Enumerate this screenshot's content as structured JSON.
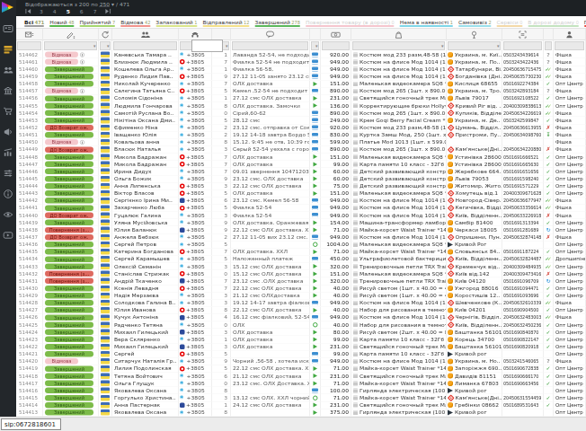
{
  "topbar": {
    "showing_prefix": "Відображаються з 200 по ",
    "showing_to": "250",
    "showing_suffix": " ▾ / 471",
    "pages": [
      "3",
      "4",
      "5",
      "6",
      "7"
    ],
    "current_page": "5"
  },
  "tabs": [
    {
      "label": "Всі",
      "count": "471",
      "color": "#9e9e9e",
      "active": true,
      "dim": false
    },
    {
      "label": "Новий",
      "count": "48",
      "color": "#57b94c",
      "active": false,
      "dim": false
    },
    {
      "label": "Прийнятий",
      "count": "7",
      "color": "#a5d66e",
      "active": false,
      "dim": false
    },
    {
      "label": "Відмова",
      "count": "42",
      "color": "#f1948d",
      "active": false,
      "dim": false
    },
    {
      "label": "Запакований",
      "count": "1",
      "color": "#d9e48a",
      "active": false,
      "dim": false
    },
    {
      "label": "Відправлений",
      "count": "12",
      "color": "#f3e08a",
      "active": false,
      "dim": false
    },
    {
      "label": "Завершений",
      "count": "278",
      "color": "#5cb85c",
      "active": false,
      "dim": false
    },
    {
      "label": "Повернення товару (в дорозі)",
      "count": "0",
      "color": "#f5c6ce",
      "active": false,
      "dim": true
    },
    {
      "label": "Нема в наявності",
      "count": "1",
      "color": "#7fd6e8",
      "active": false,
      "dim": false
    },
    {
      "label": "Самовивіз",
      "count": "2",
      "color": "#9adfeb",
      "active": false,
      "dim": false
    },
    {
      "label": "Сервіси",
      "count": "0",
      "color": "#f3d9a8",
      "active": false,
      "dim": true
    },
    {
      "label": "В дорозі додому",
      "count": "0",
      "color": "#c4e3c0",
      "active": false,
      "dim": true
    },
    {
      "label": "Пов",
      "count": "",
      "color": "#e6483c",
      "active": false,
      "dim": false
    }
  ],
  "sidebar_icons": [
    "logo",
    "id-card",
    "orders-list",
    "clients",
    "company",
    "cart",
    "megaphone",
    "stats",
    "settings-sliders",
    "info",
    "watch",
    "video"
  ],
  "columns": [
    "id",
    "status",
    "channel",
    "client",
    "phone",
    "calls-count",
    "comment",
    "payment",
    "amount",
    "products",
    "delivery-address",
    "tracking-number",
    "delivery-state",
    "source"
  ],
  "statuses": {
    "done": {
      "label": "Завершений",
      "bg": "#7cbb49",
      "fg": "#2f5c15",
      "w": 108
    },
    "refuse": {
      "label": "Відмова",
      "bg": "#f5c9cd",
      "fg": "#9c4352",
      "w": 74
    },
    "retw": {
      "label": "ДО Возврат ож.",
      "bg": "#dd695f",
      "fg": "#6e120b",
      "w": 108
    },
    "ret": {
      "label": "Повернення (з...",
      "bg": "#dd695f",
      "fg": "#6e120b",
      "w": 108
    }
  },
  "phone_prefix": "+3805",
  "table_rows": [
    [
      "514462",
      "refuse",
      true,
      "Каневська Тамара ..",
      "ks",
      "1",
      "Лаванда 52-54, не подходит",
      "card",
      "920.00",
      "Костюм мод 233 разм,48-58 (1..",
      "up",
      "Украина, м. Киї..",
      "0503243439614",
      "q",
      "Фішка"
    ],
    [
      "514461",
      "refuse",
      true,
      "Близнюк Людмила ..",
      "vf",
      "7",
      "Фиалка 52-54 не подходит",
      "card",
      "949.00",
      "Костюм на флисе Мод 1014 (1ш..",
      "up",
      "Украина, м. По..",
      "0503243422436",
      "q",
      "Фішка"
    ],
    [
      "514460",
      "done",
      false,
      "Кошелева Ольга Ар..",
      "ks",
      "1",
      "Фиалка 56-58,",
      "card",
      "949.00",
      "Костюм на флисе Мод 1014 (1ш..",
      "np",
      "Татарбунари, Ві..",
      "20450636715475",
      "ok2",
      "Фішка"
    ],
    [
      "514459",
      "done",
      false,
      "Руденко Лидия Пав..",
      "vf",
      "9",
      "27.12 11-05 занято 23.12 смс. ..",
      "card",
      "949.00",
      "Костюм на флисе Мод 1014 (1ш..",
      "np",
      "Богданівка (Дні..",
      "20450635730230",
      "ok2",
      "Фішка"
    ],
    [
      "514458",
      "done",
      false,
      "Николай Кучеренко",
      "ks",
      "7",
      "ОЛХ доставка",
      "cash",
      "151.00",
      "Маленькая видеокамера SQ8 *..",
      "up",
      "Кислиця 68655",
      "0501692274384",
      "ok",
      "Опт Центр"
    ],
    [
      "514457",
      "refuse",
      true,
      "Салєгина Татьяна С..",
      "vf",
      "5",
      "Кемел ,52-54 не подходит",
      "card",
      "890.00",
      "Костюм мод 265 (1шт. x 890.00 ..",
      "up",
      "Украина, м. Тро..",
      "0503242893184",
      "q",
      "Фішка"
    ],
    [
      "514456",
      "done",
      false,
      "Соломія Сідоніна",
      "ks",
      "1",
      "27.12 смс ОЛХ доставка",
      "cash",
      "231.00",
      "Светящийся гоночный трек Ma..",
      "up",
      "Львів 79017",
      "0501692108522",
      "ok",
      "Опт Центр"
    ],
    [
      "514455",
      "done",
      false,
      "Людмила Гончарова",
      "ks",
      "8",
      "ОЛХ доставка. Замочки",
      "cash",
      "136.00",
      "Корректирующие брюки Hollyw..",
      "np",
      "Кривий Ріг від. ..",
      "20400309838613",
      "ok2",
      "Опт Центр"
    ],
    [
      "514454",
      "done",
      false,
      "Самотій Руслана Во..",
      "ks",
      "0",
      "Сірий,60-62",
      "card",
      "890.00",
      "Костюм мод 265 (1шт. x 890.00 ..",
      "np",
      "Купиків, Відділе..",
      "20450634226619",
      "ok2",
      "Фішка"
    ],
    [
      "514453",
      "done",
      false,
      "Нікітіна Оксана Дми..",
      "ks",
      "5",
      "28.12 смс",
      "card",
      "249.00",
      "Крем Goqi Berry Facial Cream *3..",
      "up",
      "Украина, м. Де..",
      "0503242599847",
      "ok",
      "Фішка"
    ],
    [
      "514452",
      "retw",
      false,
      "Єфименко Ніна",
      "ks",
      "2",
      "23.12 смс. отправка от Сокол..",
      "card",
      "920.00",
      "Костюм мод 233 разм,48-58 (1..",
      "np",
      "Цумань, Віддiл..",
      "20450636613955",
      "red",
      "Фішка"
    ],
    [
      "514451",
      "done",
      false,
      "Іващенко Юлія",
      "ks",
      "2",
      "19.12 14-18 завтра Бордо 56-58",
      "card",
      "830.00",
      "Куртка Замш Мод, 250 (1шт. x 8..",
      "np",
      "Пристроми, Пу..",
      "20450634098760",
      "in",
      "Фішка"
    ],
    [
      "514450",
      "refuse",
      true,
      "Ковальова анна",
      "ks",
      "8",
      "15.12. 9:45 не отв, 10:39 горе в..",
      "card",
      "599.00",
      "Платье Mod 1013 (1шт. x 599.00 ..",
      "",
      "",
      "",
      "",
      "Фішка"
    ],
    [
      "514449",
      "retw",
      false,
      "Власюк Наталья",
      "ks",
      "3",
      "Серый 52-54 уехала с города",
      "card",
      "890.00",
      "Костюм мод 265 (1шт. x 890.00 ..",
      "np",
      "Кам'янське(Дні..",
      "20450634220880",
      "red",
      "Фішка"
    ],
    [
      "514448",
      "done",
      false,
      "Микола Бадражан",
      "vf",
      "7",
      "ОЛХ доставка",
      "cash",
      "151.00",
      "Маленькая видеокамера SQ8 *..",
      "up",
      "Устинівка 28600",
      "0501691666521",
      "ok",
      "Опт Центр"
    ],
    [
      "514447",
      "done",
      false,
      "Микола Бадражан",
      "vf",
      "7",
      "ОЛХ доставка",
      "cash",
      "99.00",
      "Карта памяти 10 класс - 32Гб *1..",
      "up",
      "Устинівка 28600",
      "0501691665630",
      "ok",
      "Опт Центр"
    ],
    [
      "514446",
      "done",
      false,
      "Ирина Дидух",
      "ks",
      "7",
      "09.01 звернення 10471203 04...",
      "cash",
      "60.00",
      "Детский развивающий констру..",
      "up",
      "Жеребкове 664..",
      "0501691651656",
      "ok",
      "Опт Центр"
    ],
    [
      "514445",
      "done",
      false,
      "Ольга Божик",
      "ks",
      "9",
      "23.12 смс. ОЛХ доставка",
      "cash",
      "60.00",
      "Детский развивающий констру..",
      "up",
      "Львів 79053",
      "0501691598240",
      "ok",
      "Опт Центр"
    ],
    [
      "514444",
      "done",
      false,
      "Анна Липенська",
      "vf",
      "3",
      "22.12 смс ОЛХ доставка",
      "cash",
      "75.00",
      "Детский развивающий констру..",
      "up",
      "Житомир, Жито..",
      "0501691571229",
      "ok",
      "Опт Центр"
    ],
    [
      "514443",
      "done",
      false,
      "Віктор Власов",
      "vf",
      "5",
      "ОЛХ доставка",
      "cash",
      "151.00",
      "Маленькая видеокамера SQ8 *..",
      "np",
      "Хомутець від.1",
      "20400309671628",
      "ok",
      "Опт Центр"
    ],
    [
      "514442",
      "done",
      false,
      "Сергієнко Ірина Ми..",
      "lc",
      "6",
      "23.12 смс. Кемел 56-58",
      "card",
      "949.00",
      "Костюм на флисе Мод 1014 (1ш..",
      "np",
      "Новгород-Сівер..",
      "20450636677947",
      "ok2",
      "Фішка"
    ],
    [
      "514441",
      "done",
      false,
      "Захарченко Люба",
      "vf",
      "5",
      "Фиалка 52-54",
      "card",
      "949.00",
      "Костюм на флисе Мод 1014 (1ш..",
      "np",
      "Кегичівка, Відді..",
      "20450633356614",
      "ok2",
      "Фішка"
    ],
    [
      "514440",
      "retw",
      false,
      "Гуцалюк Галина",
      "ks",
      "3",
      "Фиалка 52-54",
      "card",
      "949.00",
      "Костюм на флисе Мод 1014 (1ш..",
      "np",
      "Київ, Відділенн..",
      "20450633226918",
      "red",
      "Фішка"
    ],
    [
      "514439",
      "done",
      false,
      "Уляна Мусійовська",
      "ks",
      "9",
      "ОЛХ доставка. Оранжевая",
      "cash",
      "154.00",
      "Машина-трансформер ламборд..",
      "up",
      "Самбір 81400",
      "0501691313394",
      "ok",
      "Опт Центр"
    ],
    [
      "514438",
      "ret",
      false,
      "Юлия Баланюк",
      "lc",
      "9",
      "22.12 смс ОЛХ доставка. ХХЛ",
      "cash",
      "71.00",
      "Майка-корсет Waist Trainer *142..",
      "up",
      "Черкаси 18005",
      "0501691281689",
      "refresh",
      "Опт Центр"
    ],
    [
      "514437",
      "retw",
      false,
      "Анжела Бебзюк",
      "ks",
      "2",
      "27.12 11-05 вих 23.12 смс. 19...",
      "card",
      "949.00",
      "Костюм на флисе Мод 1014 (1ш..",
      "np",
      "Опришени, Пун..",
      "20450632874148",
      "red",
      "Фішка"
    ],
    [
      "514436",
      "done",
      false,
      "Сергей Петров",
      "ks",
      "5",
      "",
      "money",
      "1004.00",
      "Маленькая видеокамера SQ8 *..",
      "dark",
      "Кривой Рог",
      "",
      "",
      "Опт Центр"
    ],
    [
      "514435",
      "done",
      false,
      "Катерина Богданова",
      "vf",
      "7",
      "ОЛХ доставка. ХХЛ",
      "cash",
      "71.00",
      "Майка-корсет Waist Trainer *142..",
      "up",
      "Словьянськ 84..",
      "0501691187224",
      "ok",
      "Опт Центр"
    ],
    [
      "514434",
      "done",
      false,
      "Сергей Карамышев",
      "ks",
      "5",
      "Наложенный платеж",
      "card",
      "450.00",
      "Ультрафиолетовой бактерицид..",
      "np",
      "Київ, Відділенн..",
      "20450632824487",
      "ok2",
      "Дропшипінг"
    ],
    [
      "514433",
      "done",
      false,
      "Олексій Семанін",
      "ks",
      "3",
      "15.12 смс ОЛХ доставка",
      "cash",
      "320.00",
      "Тренировочные петли TRX Train..",
      "np",
      "Кременчук від..",
      "20400309484935",
      "ok2",
      "Опт Центр"
    ],
    [
      "514432",
      "ret",
      false,
      "Станіслав Стрижак",
      "vf",
      "0",
      "15.12 смс ОЛХ доставка",
      "cash",
      "151.00",
      "Маленькая видеокамера SQ8 *..",
      "np",
      "Київ від.142",
      "20400309473416",
      "red",
      "Опт Центр"
    ],
    [
      "514431",
      "ret",
      false,
      "Андрій Ткаченко",
      "lc",
      "7",
      "23.12 смс .ОЛХ доставка",
      "cash",
      "320.00",
      "Тренировочные петли TRX Train..",
      "up",
      "Київ 04120",
      "0501691096709",
      "refresh",
      "Опт Центр"
    ],
    [
      "514430",
      "done",
      false,
      "Ксенія Левадня",
      "vf",
      "7",
      "22.12 смс ОЛХ доставка",
      "cash",
      "40.00",
      "Рисуй светом (1шт. x 40.00 = 40...",
      "up",
      "Ужгород 88016",
      "0501691094471",
      "ok",
      "Опт Центр"
    ],
    [
      "514429",
      "done",
      false,
      "Надія Мерзаєва",
      "ks",
      "3",
      "21.12 смс ОЛХдоставка",
      "cash",
      "40.00",
      "Рисуй светом (1шт. x 40.00 = 40...",
      "up",
      "Коростишів 12..",
      "0501691093696",
      "ok",
      "Опт Центр"
    ],
    [
      "514428",
      "done",
      false,
      "Солодкова Галина В..",
      "ks",
      "3",
      "19.12 14-17 завтра фіалковий,..",
      "card",
      "949.00",
      "Костюм на флисе Мод 1014 (1ш..",
      "np",
      "Шевченкове (К..",
      "20450632610339",
      "ok2",
      "Фішка"
    ],
    [
      "514427",
      "done",
      false,
      "Юлия Иванова",
      "vf",
      "8",
      "22.12 смс ОЛХ доставка",
      "cash",
      "40.00",
      "Набор для рисования в темнот..",
      "up",
      "Київ 04201",
      "0501690904500",
      "ok",
      "Опт Центр"
    ],
    [
      "514426",
      "done",
      false,
      "Кучук Антоніна",
      "lc",
      "4",
      "16.12 смс фіалковий, 52-54",
      "card",
      "949.00",
      "Костюм на флисе Мод 1014 (1ш..",
      "np",
      "Чернігів, Віддiл..",
      "20450632483003",
      "ok2",
      "Фішка"
    ],
    [
      "514425",
      "done",
      false,
      "Радченко Тетяна",
      "ks",
      "0",
      "ОЛХ",
      "money",
      "40.00",
      "Набор для рисования в темнот..",
      "np",
      "Київ, Відділенн..",
      "20450632450236",
      "ok",
      "Опт Центр"
    ],
    [
      "514424",
      "done",
      false,
      "Михаил Гилецький",
      "lc",
      "3",
      "ОЛХ доставка",
      "cash",
      "80.00",
      "Рисуй светом (2шт. x 40.00 = 80...",
      "up",
      "Баштанка 56101",
      "0501690840870",
      "ok",
      "Опт Центр"
    ],
    [
      "514423",
      "done",
      false,
      "Вера Скляренко",
      "ks",
      "1",
      "ОЛХ доставка",
      "cash",
      "99.00",
      "Карта памяти 10 класс - 32Гб *1..",
      "up",
      "Корець 34700",
      "0501690822147",
      "ok",
      "Опт Центр"
    ],
    [
      "514422",
      "done",
      false,
      "Михаил Гилецький",
      "lc",
      "3",
      "ОЛХ доставка",
      "cash",
      "231.00",
      "Светящийся гоночный трек Ma..",
      "up",
      "Баштанка 56101",
      "0501690820918",
      "ok",
      "Опт Центр"
    ],
    [
      "514421",
      "done",
      false,
      "Сергей",
      "vf",
      "5",
      "",
      "card",
      "99.00",
      "Карта памяти 10 класс - 32Гб *1..",
      "dark",
      "Кривой рог",
      "",
      "",
      "Опт Центр"
    ],
    [
      "514420",
      "refuse",
      false,
      "Ситарчук Наталія Гр..",
      "ks",
      "9",
      "Чорний ,56-58 , хотела исключ..",
      "card",
      "949.00",
      "Костюм на флисе Мод 1014 (1ш..",
      "up",
      "Украина, м. Но..",
      "0503241546065",
      "q",
      "Фішка"
    ],
    [
      "514419",
      "done",
      false,
      "Лилия Подолинская",
      "vf",
      "5",
      "22.12 смс ОЛХ доставка. ХХХЛ",
      "cash",
      "71.00",
      "Майка-корсет Waist Trainer *142..",
      "up",
      "Запоріжжя 690..",
      "0501690672838",
      "ok",
      "Опт Центр"
    ],
    [
      "514418",
      "done",
      false,
      "Тетяна Войтович",
      "ks",
      "6",
      "21.12 смс ОЛХ доставка",
      "cash",
      "231.00",
      "Светящийся гоночный трек Ma..",
      "up",
      "Давидів 81151",
      "0501690666170",
      "ok",
      "Опт Центр"
    ],
    [
      "514417",
      "done",
      false,
      "Ольга Глущук",
      "ks",
      "0",
      "23.12 смс. ОЛХ Доставка. ХХХ..",
      "cash",
      "71.00",
      "Майка-корсет Waist Trainer *142..",
      "up",
      "Лиманка 67803",
      "0501690663456",
      "ok",
      "Опт Центр"
    ],
    [
      "514416",
      "done",
      false,
      "Яковалева Оксана",
      "ks",
      "8",
      "",
      "card",
      "100.00",
      "Гирлянда электрическая (100 л..",
      "dark",
      "Кривой рог",
      "",
      "",
      "Опт Центр"
    ],
    [
      "514415",
      "done",
      false,
      "Горгулько Христина..",
      "ks",
      "3",
      "13.12 смс ОЛХ. ХХЛ чорний",
      "money",
      "71.00",
      "Майка-корсет Waist Trainer *142..",
      "np",
      "Кам'янське(Дні..",
      "20450631554459",
      "ok",
      "Опт Центр"
    ],
    [
      "514414",
      "done",
      false,
      "Анна Пастернак",
      "lc",
      "1",
      "24.12 смс ОЛХ доставка",
      "cash",
      "231.00",
      "Светящийся гоночный трек Ma..",
      "up",
      "Гребінки 08662",
      "0501689531643",
      "ok",
      "Опт Центр"
    ],
    [
      "514413",
      "done",
      false,
      "Яковалева Оксана",
      "ks",
      "8",
      "",
      "cash",
      "375.00",
      "Гирлянда электрическая (100 л..",
      "dark",
      "Кривой рог",
      "",
      "",
      "Опт Центр"
    ]
  ],
  "statusbar": {
    "sip": "sip:0672818601"
  }
}
